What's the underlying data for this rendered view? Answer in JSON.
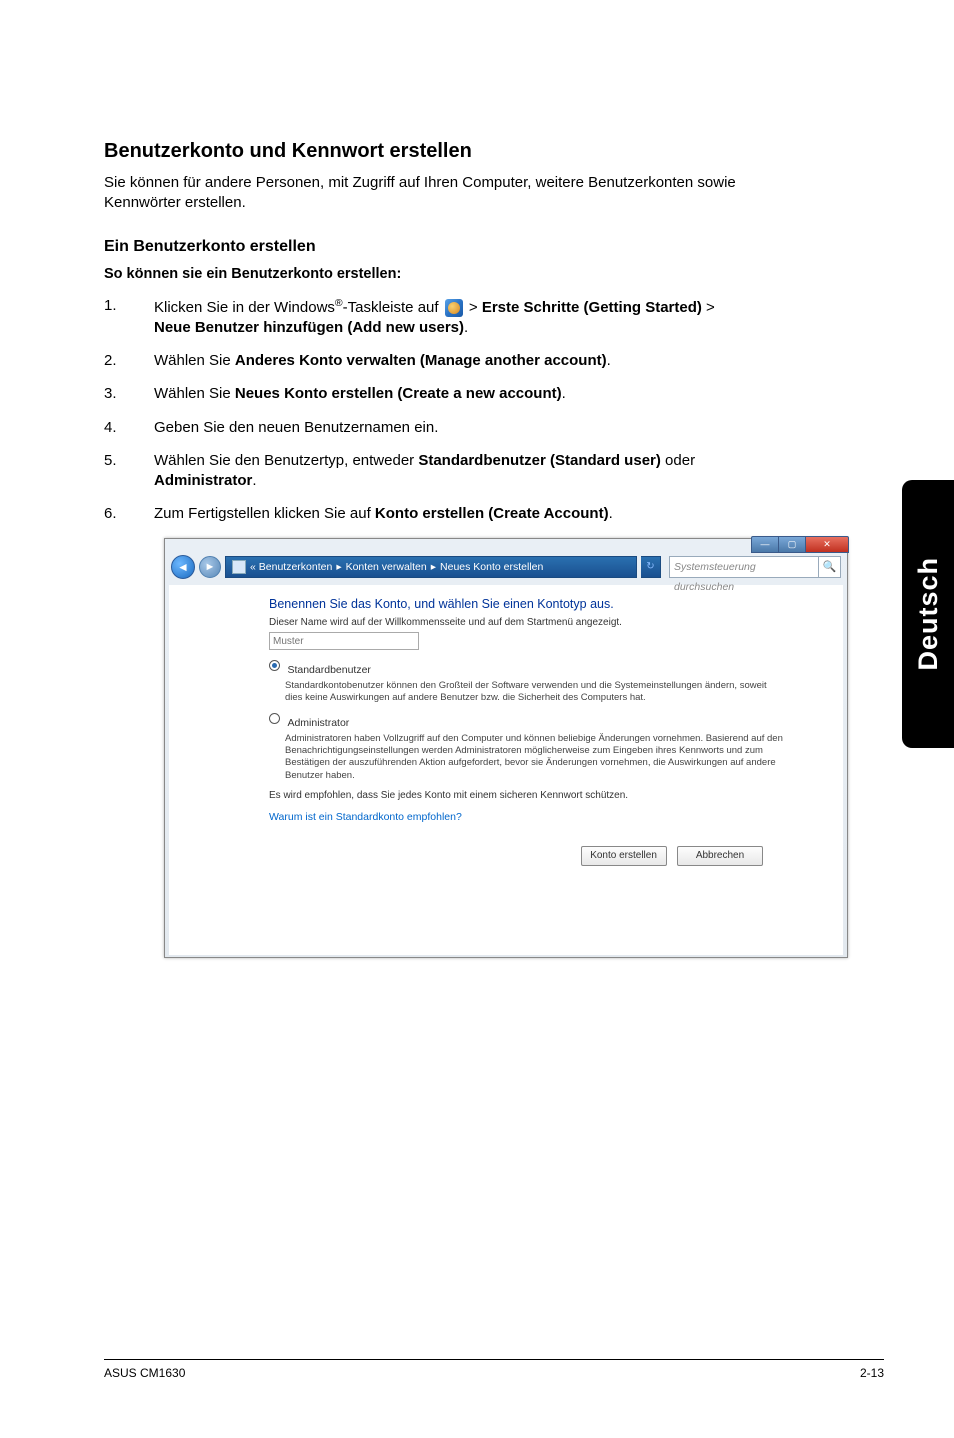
{
  "heading": "Benutzerkonto und Kennwort erstellen",
  "intro": "Sie können für andere Personen, mit Zugriff auf Ihren Computer, weitere Benutzerkonten sowie Kennwörter erstellen.",
  "subheading": "Ein Benutzerkonto erstellen",
  "steps_heading": "So können sie ein Benutzerkonto erstellen:",
  "steps": {
    "s1": {
      "num": "1.",
      "pre": "Klicken Sie in der Windows",
      "reg": "®",
      "mid": "-Taskleiste auf ",
      "gt1": " > ",
      "bold1": "Erste Schritte (Getting Started)",
      "gt2": " > ",
      "bold2": "Neue Benutzer hinzufügen (Add new users)",
      "end": "."
    },
    "s2": {
      "num": "2.",
      "pre": "Wählen Sie ",
      "bold": "Anderes Konto verwalten (Manage another account)",
      "end": "."
    },
    "s3": {
      "num": "3.",
      "pre": "Wählen Sie ",
      "bold": "Neues Konto erstellen (Create a new account)",
      "end": "."
    },
    "s4": {
      "num": "4.",
      "text": "Geben Sie den neuen Benutzernamen ein."
    },
    "s5": {
      "num": "5.",
      "pre": "Wählen Sie den Benutzertyp, entweder ",
      "bold1": "Standardbenutzer (Standard user)",
      "mid": " oder ",
      "bold2": "Administrator",
      "end": "."
    },
    "s6": {
      "num": "6.",
      "pre": "Zum Fertigstellen klicken Sie auf ",
      "bold": "Konto erstellen (Create Account)",
      "end": "."
    }
  },
  "window": {
    "breadcrumb": {
      "sep": "▸",
      "p1": "« Benutzerkonten",
      "p2": "Konten verwalten",
      "p3": "Neues Konto erstellen"
    },
    "refresh": "↻",
    "search_placeholder": "Systemsteuerung durchsuchen",
    "search_icon": "🔍",
    "instruction": "Benennen Sie das Konto, und wählen Sie einen Kontotyp aus.",
    "subtext": "Dieser Name wird auf der Willkommensseite und auf dem Startmenü angezeigt.",
    "name_placeholder": "Muster",
    "radio_standard": {
      "label": "Standardbenutzer",
      "desc": "Standardkontobenutzer können den Großteil der Software verwenden und die Systemeinstellungen ändern, soweit dies keine Auswirkungen auf andere Benutzer bzw. die Sicherheit des Computers hat."
    },
    "radio_admin": {
      "label": "Administrator",
      "desc": "Administratoren haben Vollzugriff auf den Computer und können beliebige Änderungen vornehmen. Basierend auf den Benachrichtigungseinstellungen werden Administratoren möglicherweise zum Eingeben ihres Kennworts und zum Bestätigen der auszuführenden Aktion aufgefordert, bevor sie Änderungen vornehmen, die Auswirkungen auf andere Benutzer haben."
    },
    "recommendation": "Es wird empfohlen, dass Sie jedes Konto mit einem sicheren Kennwort schützen.",
    "why_link": "Warum ist ein Standardkonto empfohlen?",
    "btn_create": "Konto erstellen",
    "btn_cancel": "Abbrechen"
  },
  "side_tab": "Deutsch",
  "footer": {
    "left": "ASUS CM1630",
    "right": "2-13"
  }
}
